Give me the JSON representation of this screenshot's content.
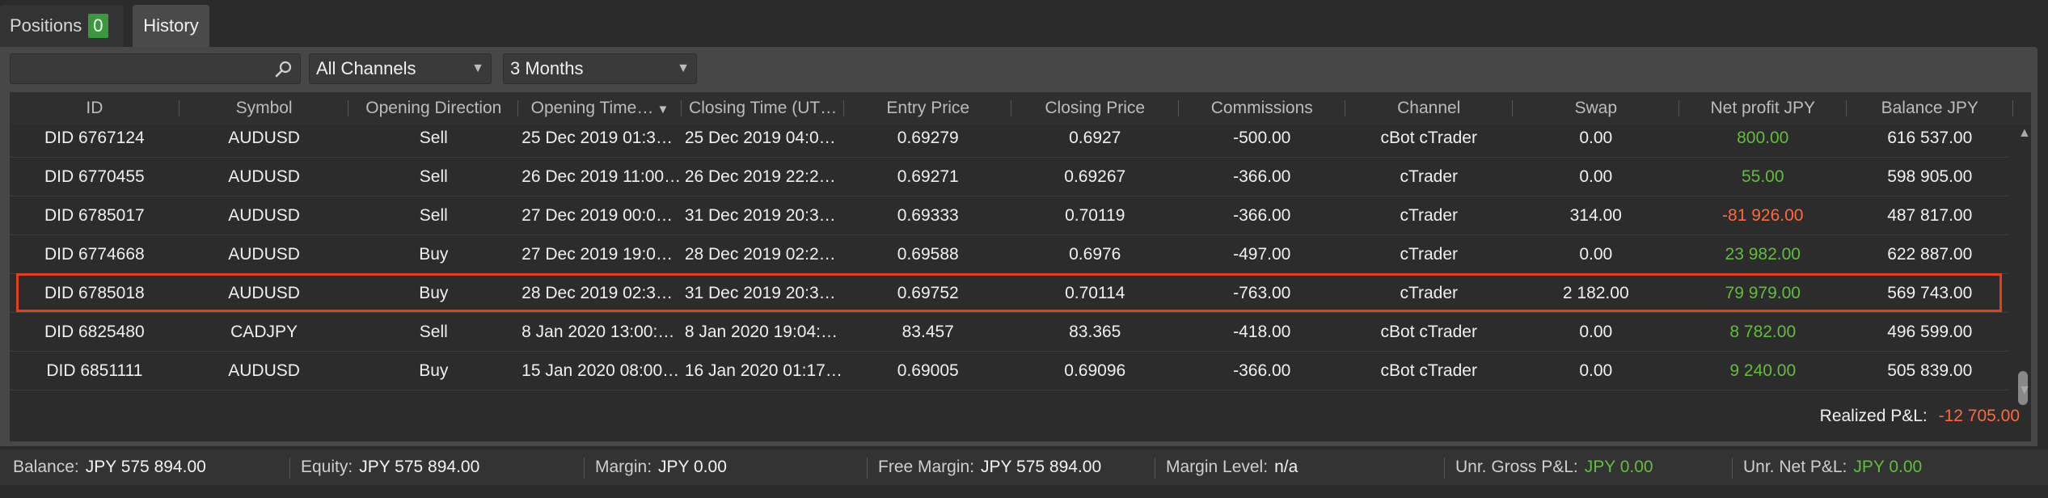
{
  "tabs": [
    {
      "label": "Positions",
      "badge": "0"
    },
    {
      "label": "History"
    }
  ],
  "filters": {
    "search_placeholder": "",
    "channel": "All Channels",
    "period": "3 Months"
  },
  "table": {
    "columns": [
      "ID",
      "Symbol",
      "Opening Direction",
      "Opening Time…",
      "Closing Time (UT…",
      "Entry Price",
      "Closing Price",
      "Commissions",
      "Channel",
      "Swap",
      "Net profit JPY",
      "Balance JPY"
    ],
    "rows": [
      {
        "id": "DID 6767124",
        "symbol": "AUDUSD",
        "direction": "Sell",
        "open": "25 Dec 2019 01:3…",
        "close": "25 Dec 2019 04:0…",
        "entry": "0.69279",
        "closing": "0.6927",
        "commissions": "-500.00",
        "channel": "cBot cTrader",
        "swap": "0.00",
        "net": "800.00",
        "net_sign": "pos",
        "balance": "616 537.00"
      },
      {
        "id": "DID 6770455",
        "symbol": "AUDUSD",
        "direction": "Sell",
        "open": "26 Dec 2019 11:00…",
        "close": "26 Dec 2019 22:2…",
        "entry": "0.69271",
        "closing": "0.69267",
        "commissions": "-366.00",
        "channel": "cTrader",
        "swap": "0.00",
        "net": "55.00",
        "net_sign": "pos",
        "balance": "598 905.00"
      },
      {
        "id": "DID 6785017",
        "symbol": "AUDUSD",
        "direction": "Sell",
        "open": "27 Dec 2019 00:0…",
        "close": "31 Dec 2019 20:3…",
        "entry": "0.69333",
        "closing": "0.70119",
        "commissions": "-366.00",
        "channel": "cTrader",
        "swap": "314.00",
        "net": "-81 926.00",
        "net_sign": "neg",
        "balance": "487 817.00"
      },
      {
        "id": "DID 6774668",
        "symbol": "AUDUSD",
        "direction": "Buy",
        "open": "27 Dec 2019 19:0…",
        "close": "28 Dec 2019 02:2…",
        "entry": "0.69588",
        "closing": "0.6976",
        "commissions": "-497.00",
        "channel": "cTrader",
        "swap": "0.00",
        "net": "23 982.00",
        "net_sign": "pos",
        "balance": "622 887.00"
      },
      {
        "id": "DID 6785018",
        "symbol": "AUDUSD",
        "direction": "Buy",
        "open": "28 Dec 2019 02:3…",
        "close": "31 Dec 2019 20:3…",
        "entry": "0.69752",
        "closing": "0.70114",
        "commissions": "-763.00",
        "channel": "cTrader",
        "swap": "2 182.00",
        "net": "79 979.00",
        "net_sign": "pos",
        "balance": "569 743.00",
        "selected": true
      },
      {
        "id": "DID 6825480",
        "symbol": "CADJPY",
        "direction": "Sell",
        "open": "8 Jan 2020 13:00:…",
        "close": "8 Jan 2020 19:04:…",
        "entry": "83.457",
        "closing": "83.365",
        "commissions": "-418.00",
        "channel": "cBot cTrader",
        "swap": "0.00",
        "net": "8 782.00",
        "net_sign": "pos",
        "balance": "496 599.00"
      },
      {
        "id": "DID 6851111",
        "symbol": "AUDUSD",
        "direction": "Buy",
        "open": "15 Jan 2020 08:00…",
        "close": "16 Jan 2020 01:17…",
        "entry": "0.69005",
        "closing": "0.69096",
        "commissions": "-366.00",
        "channel": "cBot cTrader",
        "swap": "0.00",
        "net": "9 240.00",
        "net_sign": "pos",
        "balance": "505 839.00"
      }
    ]
  },
  "realized": {
    "label": "Realized P&L:",
    "value": "-12 705.00"
  },
  "status": [
    {
      "key": "Balance:",
      "value": "JPY 575 894.00",
      "color": ""
    },
    {
      "key": "Equity:",
      "value": "JPY 575 894.00",
      "color": ""
    },
    {
      "key": "Margin:",
      "value": "JPY 0.00",
      "color": ""
    },
    {
      "key": "Free Margin:",
      "value": "JPY 575 894.00",
      "color": ""
    },
    {
      "key": "Margin Level:",
      "value": "n/a",
      "color": ""
    },
    {
      "key": "Unr. Gross P&L:",
      "value": "JPY 0.00",
      "color": "green"
    },
    {
      "key": "Unr. Net P&L:",
      "value": "JPY 0.00",
      "color": "green"
    }
  ],
  "colors": {
    "accent_selected": "#e0401a",
    "positive": "#5fbf3a",
    "negative": "#ff6a3a"
  },
  "icons": {
    "search": "search-icon",
    "sort": "sort-desc-icon"
  }
}
